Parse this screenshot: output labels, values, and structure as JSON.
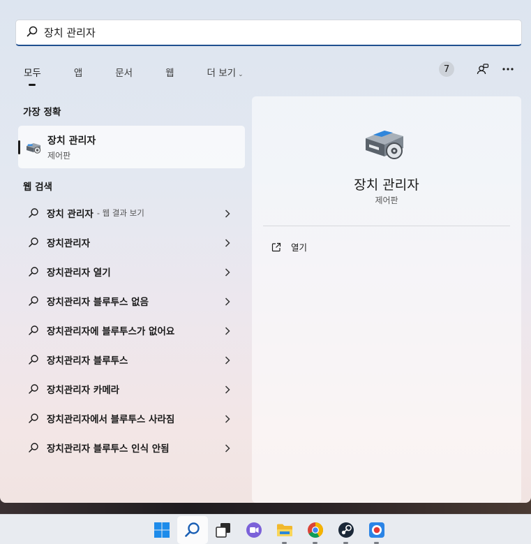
{
  "search": {
    "value": "장치 관리자"
  },
  "tabs": [
    {
      "label": "모두",
      "active": true
    },
    {
      "label": "앱"
    },
    {
      "label": "문서"
    },
    {
      "label": "웹"
    },
    {
      "label": "더 보기",
      "has_dropdown": true
    }
  ],
  "toolbar": {
    "badge_count": "7",
    "icons": [
      "account-switch-icon",
      "more-options-icon"
    ]
  },
  "best_match": {
    "section_title": "가장 정확",
    "name": "장치 관리자",
    "subtitle": "제어판",
    "icon": "device-manager-icon"
  },
  "web_search": {
    "section_title": "웹 검색",
    "items": [
      {
        "label": "장치 관리자",
        "suffix": "- 웹 결과 보기"
      },
      {
        "label": "장치관리자",
        "suffix": ""
      },
      {
        "label": "장치관리자 열기",
        "suffix": ""
      },
      {
        "label": "장치관리자 블루투스 없음",
        "suffix": ""
      },
      {
        "label": "장치관리자에 블루투스가 없어요",
        "suffix": ""
      },
      {
        "label": "장치관리자 블루투스",
        "suffix": ""
      },
      {
        "label": "장치관리자 카메라",
        "suffix": ""
      },
      {
        "label": "장치관리자에서 블루투스 사라짐",
        "suffix": ""
      },
      {
        "label": "장치관리자 블루투스 인식 안됨",
        "suffix": ""
      }
    ]
  },
  "detail": {
    "name": "장치 관리자",
    "subtitle": "제어판",
    "actions": [
      {
        "label": "열기",
        "icon": "open-external-icon"
      }
    ]
  },
  "taskbar": {
    "items": [
      {
        "icon": "windows-start-icon"
      },
      {
        "icon": "search-icon",
        "active": true
      },
      {
        "icon": "task-view-icon"
      },
      {
        "icon": "chat-icon"
      },
      {
        "icon": "file-explorer-icon",
        "running": true
      },
      {
        "icon": "chrome-icon",
        "running": true
      },
      {
        "icon": "steam-icon",
        "running": true
      },
      {
        "icon": "screen-recorder-icon",
        "running": true
      }
    ]
  },
  "colors": {
    "accent": "#1f4f8f",
    "windows_blue": "#1d8bea"
  }
}
